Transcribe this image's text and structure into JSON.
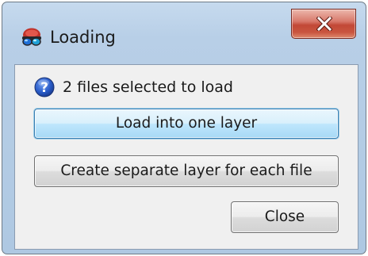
{
  "window": {
    "title": "Loading"
  },
  "titlebar": {
    "close_icon": "close-x-icon",
    "app_icon": "3d-glasses-icon"
  },
  "message": {
    "icon": "question-icon",
    "text": "2 files selected to load"
  },
  "buttons": {
    "load_one": "Load into one layer",
    "separate": "Create separate layer for each file",
    "close": "Close"
  },
  "colors": {
    "titlebar": "#b8cfe7",
    "close_button": "#c24836",
    "focused_button": "#bee6fd",
    "dialog_background": "#f0f0f0"
  }
}
